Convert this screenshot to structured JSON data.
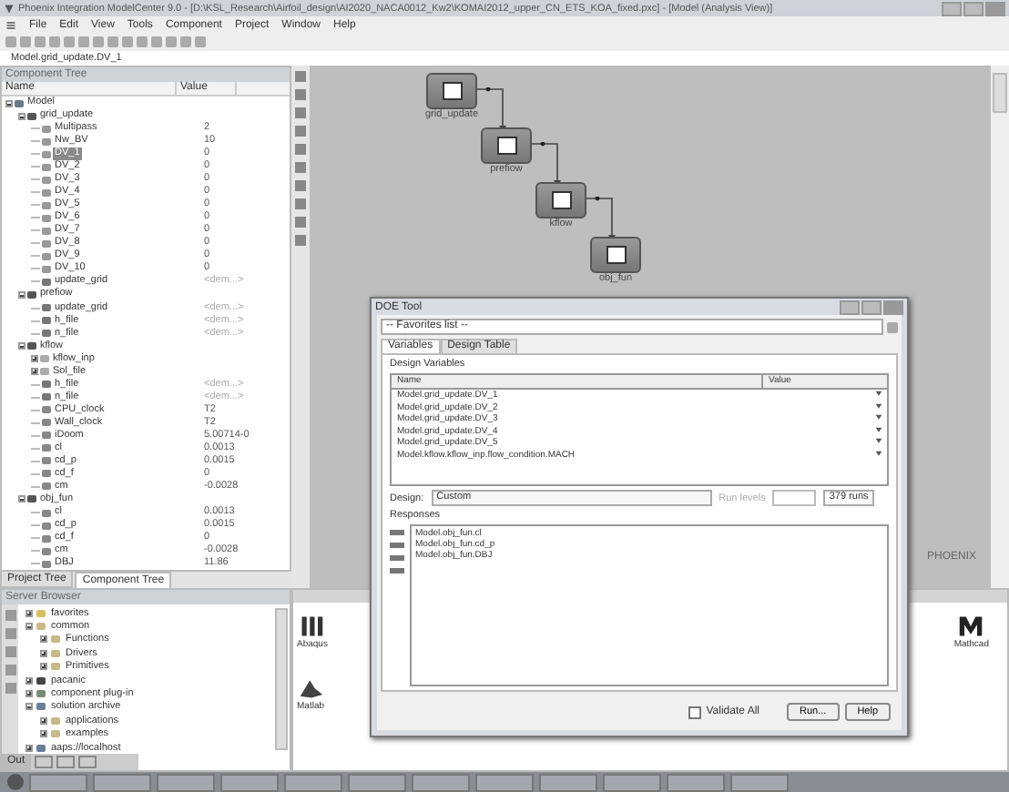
{
  "window": {
    "title": "Phoenix Integration ModelCenter 9.0 - [D:\\KSL_Research\\Airfoil_design\\AI2020_NACA0012_Kw2\\KOMAI2012_upper_CN_ETS_KOA_fixed.pxc] - [Model (Analysis View)]"
  },
  "menu": [
    "File",
    "Edit",
    "View",
    "Tools",
    "Component",
    "Project",
    "Window",
    "Help"
  ],
  "breadcrumb": "Model.grid_update.DV_1",
  "component_tree": {
    "title": "Component Tree",
    "columns": [
      "Name",
      "Value"
    ],
    "nodes": [
      {
        "name": "Model",
        "kind": "model",
        "selected": false,
        "expanded": true,
        "children": [
          {
            "name": "grid_update",
            "kind": "component",
            "selected": false,
            "expanded": true,
            "children": [
              {
                "name": "Multipass",
                "value": "2",
                "kind": "var",
                "selected": false
              },
              {
                "name": "Nw_BV",
                "value": "10",
                "kind": "var",
                "selected": false
              },
              {
                "name": "DV_1",
                "value": "0",
                "kind": "var",
                "selected": true
              },
              {
                "name": "DV_2",
                "value": "0",
                "kind": "var",
                "selected": false
              },
              {
                "name": "DV_3",
                "value": "0",
                "kind": "var",
                "selected": false
              },
              {
                "name": "DV_4",
                "value": "0",
                "kind": "var",
                "selected": false
              },
              {
                "name": "DV_5",
                "value": "0",
                "kind": "var",
                "selected": false
              },
              {
                "name": "DV_6",
                "value": "0",
                "kind": "var",
                "selected": false
              },
              {
                "name": "DV_7",
                "value": "0",
                "kind": "var",
                "selected": false
              },
              {
                "name": "DV_8",
                "value": "0",
                "kind": "var",
                "selected": false
              },
              {
                "name": "DV_9",
                "value": "0",
                "kind": "var",
                "selected": false
              },
              {
                "name": "DV_10",
                "value": "0",
                "kind": "var",
                "selected": false
              },
              {
                "name": "update_grid",
                "value": "<dem...>",
                "kind": "file",
                "selected": false
              }
            ]
          },
          {
            "name": "prefiow",
            "kind": "component",
            "selected": false,
            "expanded": true,
            "children": [
              {
                "name": "update_grid",
                "value": "<dem...>",
                "kind": "file",
                "selected": false
              },
              {
                "name": "h_file",
                "value": "<dem...>",
                "kind": "file",
                "selected": false
              },
              {
                "name": "n_file",
                "value": "<dem...>",
                "kind": "file",
                "selected": false
              }
            ]
          },
          {
            "name": "kflow",
            "kind": "component",
            "selected": false,
            "expanded": true,
            "children": [
              {
                "name": "kflow_inp",
                "kind": "group",
                "selected": false,
                "expanded": false
              },
              {
                "name": "Sol_file",
                "kind": "group",
                "selected": false,
                "expanded": false
              },
              {
                "name": "h_file",
                "value": "<dem...>",
                "kind": "file",
                "selected": false
              },
              {
                "name": "n_file",
                "value": "<dem...>",
                "kind": "file",
                "selected": false
              },
              {
                "name": "CPU_clock",
                "value": "T2",
                "kind": "out",
                "selected": false
              },
              {
                "name": "Wall_clock",
                "value": "T2",
                "kind": "out",
                "selected": false
              },
              {
                "name": "iDoom",
                "value": "5.00714-0",
                "kind": "out",
                "selected": false
              },
              {
                "name": "cl",
                "value": "0.0013",
                "kind": "out",
                "selected": false
              },
              {
                "name": "cd_p",
                "value": "0.0015",
                "kind": "out",
                "selected": false
              },
              {
                "name": "cd_f",
                "value": "0",
                "kind": "out",
                "selected": false
              },
              {
                "name": "cm",
                "value": "-0.0028",
                "kind": "out",
                "selected": false
              }
            ]
          },
          {
            "name": "obj_fun",
            "kind": "component",
            "selected": false,
            "expanded": true,
            "children": [
              {
                "name": "cl",
                "value": "0.0013",
                "kind": "out",
                "selected": false
              },
              {
                "name": "cd_p",
                "value": "0.0015",
                "kind": "out",
                "selected": false
              },
              {
                "name": "cd_f",
                "value": "0",
                "kind": "out",
                "selected": false
              },
              {
                "name": "cm",
                "value": "-0.0028",
                "kind": "out",
                "selected": false
              },
              {
                "name": "DBJ",
                "value": "11.86",
                "kind": "out",
                "selected": false
              }
            ]
          }
        ]
      }
    ]
  },
  "panel_tabs": [
    {
      "label": "Project Tree",
      "selected": false
    },
    {
      "label": "Component Tree",
      "selected": true
    }
  ],
  "server_browser": {
    "title": "Server Browser",
    "nodes": [
      {
        "name": "favorites",
        "kind": "star",
        "expanded": false
      },
      {
        "name": "common",
        "kind": "folder",
        "expanded": true,
        "children": [
          {
            "name": "Functions",
            "kind": "folder",
            "expanded": false
          },
          {
            "name": "Drivers",
            "kind": "folder",
            "expanded": false
          },
          {
            "name": "Primitives",
            "kind": "folder",
            "expanded": false
          }
        ]
      },
      {
        "name": "pacanic",
        "kind": "figure",
        "expanded": false
      },
      {
        "name": "component plug-in",
        "kind": "plug",
        "expanded": false
      },
      {
        "name": "solution archive",
        "kind": "globe",
        "expanded": true,
        "children": [
          {
            "name": "applications",
            "kind": "folder",
            "expanded": false
          },
          {
            "name": "examples",
            "kind": "folder",
            "expanded": false
          }
        ]
      },
      {
        "name": "aaps://localhost",
        "kind": "globe",
        "expanded": false
      }
    ]
  },
  "output_tab": "Out",
  "canvas": {
    "nodes": [
      {
        "label": "grid_update"
      },
      {
        "label": "prefiow"
      },
      {
        "label": "kflow"
      },
      {
        "label": "obj_fun"
      }
    ],
    "watermark": "PHOENIX"
  },
  "library": [
    {
      "label": "Abaqus",
      "kind": "rack"
    },
    {
      "label": "Matlab",
      "kind": "matlab"
    },
    {
      "label": "Mathcad",
      "kind": "m"
    }
  ],
  "doe_dialog": {
    "title": "DOE Tool",
    "favorites": "-- Favorites list --",
    "tabs": [
      {
        "label": "Variables",
        "selected": true
      },
      {
        "label": "Design Table",
        "selected": false
      }
    ],
    "design_variables": {
      "title": "Design Variables",
      "columns": [
        "Name",
        "Value"
      ],
      "rows": [
        "Model.grid_update.DV_1",
        "Model.grid_update.DV_2",
        "Model.grid_update.DV_3",
        "Model.grid_update.DV_4",
        "Model.grid_update.DV_5",
        "Model.kflow.kflow_inp.flow_condition.MACH"
      ]
    },
    "design_label": "Design:",
    "design": "Custom",
    "run_levels_label": "Run levels",
    "runs": "379 runs",
    "responses": {
      "title": "Responses",
      "rows": [
        "Model.obj_fun.cl",
        "Model.obj_fun.cd_p",
        "Model.obj_fun.DBJ"
      ]
    },
    "validate_all": {
      "label": "Validate All",
      "checked": false
    },
    "buttons": [
      "Run...",
      "Help"
    ]
  }
}
